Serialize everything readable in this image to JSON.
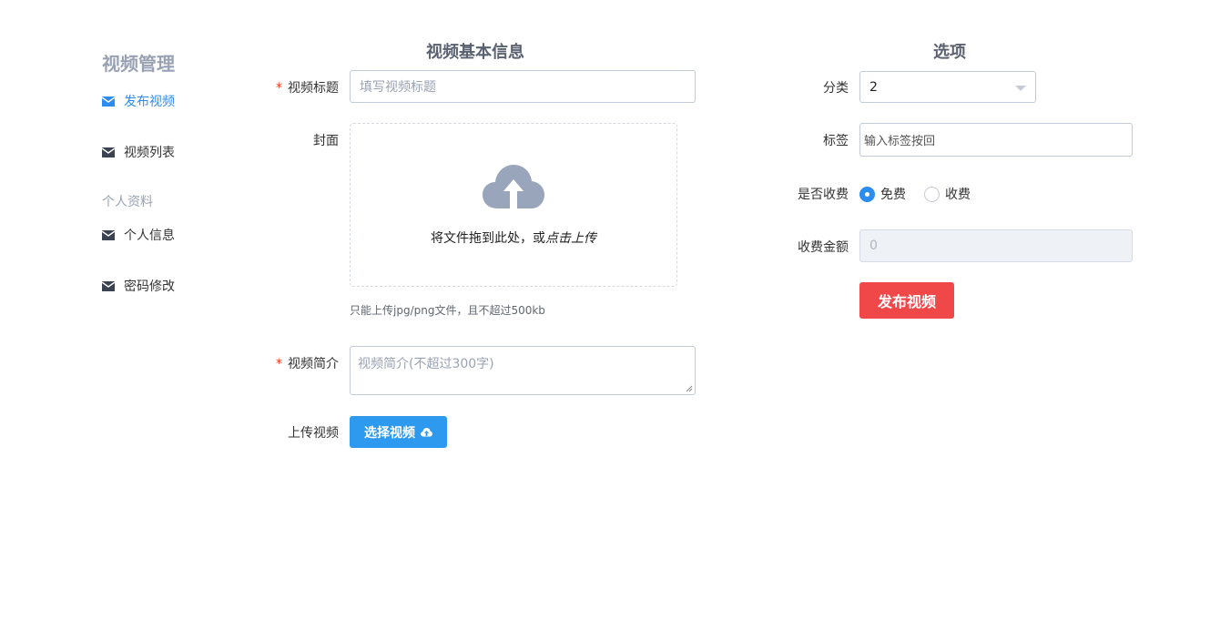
{
  "sidebar": {
    "heading": "视频管理",
    "subheading": "个人资料",
    "items": [
      {
        "label": "发布视频",
        "icon": "mail-icon"
      },
      {
        "label": "视频列表",
        "icon": "mail-icon"
      },
      {
        "label": "个人信息",
        "icon": "mail-icon"
      },
      {
        "label": "密码修改",
        "icon": "mail-icon"
      }
    ]
  },
  "basic": {
    "title": "视频基本信息",
    "required_mark": "*",
    "title_label": "视频标题",
    "title_placeholder": "填写视频标题",
    "cover_label": "封面",
    "upload_text_prefix": "将文件拖到此处，或",
    "upload_text_link": "点击上传",
    "upload_tip": "只能上传jpg/png文件，且不超过500kb",
    "intro_label": "视频简介",
    "intro_placeholder": "视频简介(不超过300字)",
    "video_label": "上传视频",
    "video_button": "选择视频"
  },
  "options": {
    "title": "选项",
    "category_label": "分类",
    "category_value": "2",
    "tags_label": "标签",
    "tags_placeholder": "输入标签按回",
    "charge_label": "是否收费",
    "charge_options": [
      "免费",
      "收费"
    ],
    "charge_selected": "免费",
    "amount_label": "收费金额",
    "amount_value": "0",
    "publish_button": "发布视频"
  },
  "colors": {
    "accent": "#2d8cf0",
    "button_blue": "#2d9af0",
    "button_red": "#f04848",
    "required": "#ed4014"
  }
}
